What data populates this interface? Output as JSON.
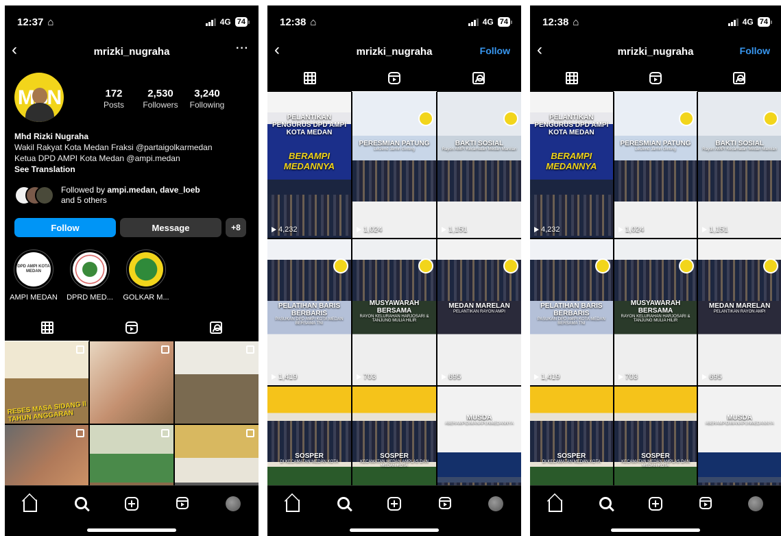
{
  "status": {
    "phone1_time": "12:37",
    "phone2_time": "12:38",
    "phone3_time": "12:38",
    "network": "4G",
    "battery": "74"
  },
  "profile": {
    "username": "mrizki_nugraha",
    "more_label": "···",
    "follow_link": "Follow",
    "avatar_text": "MBN",
    "posts_count": "172",
    "posts_label": "Posts",
    "followers_count": "2,530",
    "followers_label": "Followers",
    "following_count": "3,240",
    "following_label": "Following",
    "name": "Mhd Rizki Nugraha",
    "bio_line1": "Wakil Rakyat Kota Medan Fraksi @partaigolkarmedan",
    "bio_line2": "Ketua DPD AMPI Kota Medan @ampi.medan",
    "see_translation": "See Translation",
    "followed_by_prefix": "Followed by ",
    "followed_by_names": "ampi.medan, dave_loeb",
    "followed_by_suffix": "and 5 others",
    "follow_button": "Follow",
    "message_button": "Message",
    "add_user_icon": "+8"
  },
  "highlights": [
    {
      "label": "AMPI MEDAN",
      "inner": "DPD AMPI KOTA MEDAN"
    },
    {
      "label": "DPRD MED...",
      "inner": ""
    },
    {
      "label": "GOLKAR M...",
      "inner": ""
    }
  ],
  "posts": [
    {
      "overlay": "RESES MASA SIDANG II TAHUN ANGGARAN",
      "bg": "#e4d7b6"
    },
    {
      "overlay": "",
      "bg": "#c9a98d"
    },
    {
      "overlay": "",
      "bg": "#8a7a64"
    },
    {
      "overlay": "",
      "bg": "#b0856a"
    },
    {
      "overlay": "",
      "bg": "#7a9a6a"
    },
    {
      "overlay": "",
      "bg": "#c8b26a"
    }
  ],
  "reels": [
    {
      "title": "PELANTIKAN PENGURUS DPD AMPI KOTA MEDAN",
      "subtitle": "",
      "brand": "BERAMPI MEDANNYA",
      "views": "4,232"
    },
    {
      "title": "PERESMIAN PATUNG",
      "subtitle": "LetJend Jamin Ginting",
      "views": "1,024"
    },
    {
      "title": "BAKTI SOSIAL",
      "subtitle": "Rayon AMPI Kecamatan Medan Marelan",
      "views": "1,151"
    },
    {
      "title": "PELATIHAN BARIS BERBARIS",
      "subtitle": "PASUKAN DPD AMPI KOTA MEDAN BERSAMA TNI",
      "views": "1,419"
    },
    {
      "title": "MUSYAWARAH BERSAMA",
      "subtitle": "RAYON KELURAHAN HARJOSARI & TANJUNG MULIA HILIR",
      "views": "703"
    },
    {
      "title": "MEDAN MARELAN",
      "subtitle": "PELANTIKAN RAYON AMPI",
      "views": "695"
    },
    {
      "title": "SOSPER",
      "subtitle": "DI KECAMATAN MEDAN KOTA",
      "views": ""
    },
    {
      "title": "SOSPER",
      "subtitle": "KECAMATAN MEDAN AMPLAS DAN MEDAN KOTA",
      "views": ""
    },
    {
      "title": "MUSDA",
      "subtitle": "#BERAMPIDIMANAPUNMEDANNYA",
      "views": ""
    }
  ],
  "colors": {
    "accent_blue": "#0095f6",
    "follow_link_blue": "#3897f0",
    "brand_yellow": "#f2d51b"
  }
}
